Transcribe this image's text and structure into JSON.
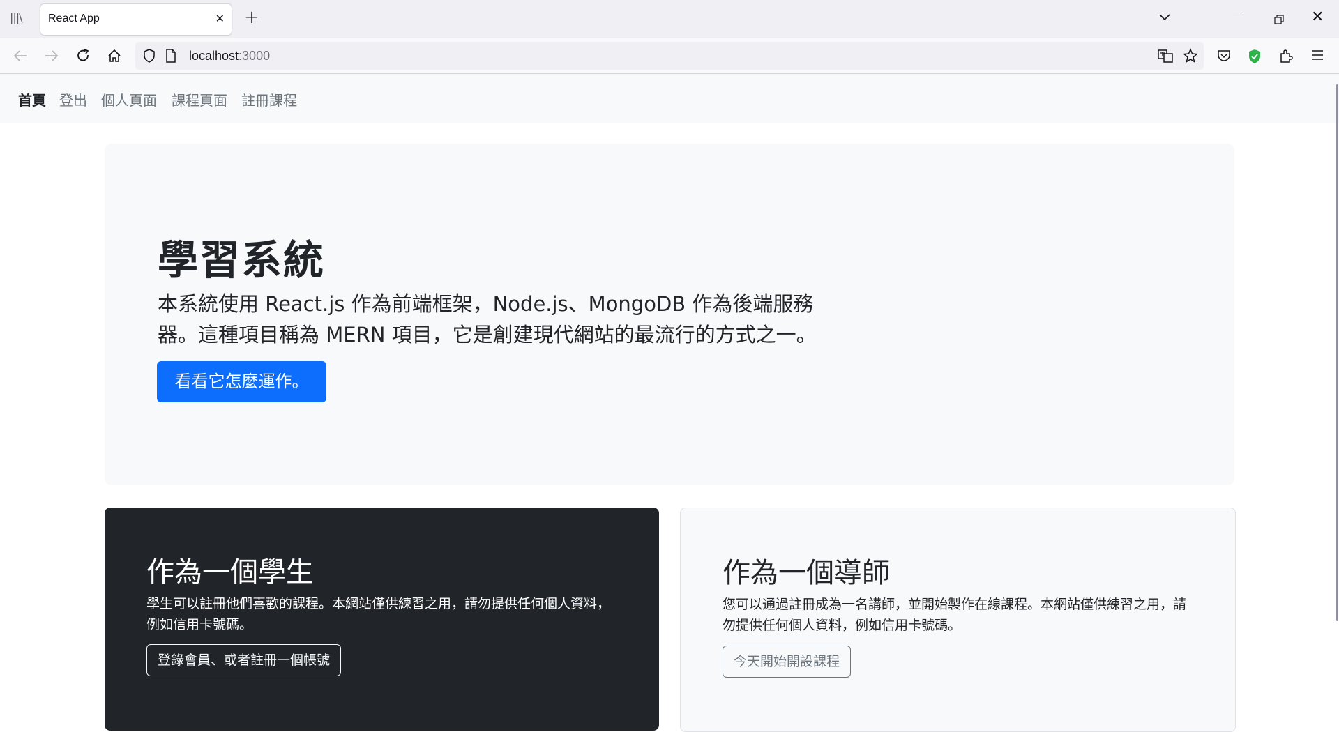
{
  "browser": {
    "tab_title": "React App",
    "url_host": "localhost",
    "url_port": ":3000"
  },
  "nav": {
    "items": [
      "首頁",
      "登出",
      "個人頁面",
      "課程頁面",
      "註冊課程"
    ]
  },
  "hero": {
    "title": "學習系統",
    "lead": "本系統使用 React.js 作為前端框架，Node.js、MongoDB 作為後端服務器。這種項目稱為 MERN 項目，它是創建現代網站的最流行的方式之一。",
    "button_label": "看看它怎麼運作。"
  },
  "student_card": {
    "title": "作為一個學生",
    "text": "學生可以註冊他們喜歡的課程。本網站僅供練習之用，請勿提供任何個人資料，例如信用卡號碼。",
    "button_label": "登錄會員、或者註冊一個帳號"
  },
  "instructor_card": {
    "title": "作為一個導師",
    "text": "您可以通過註冊成為一名講師，並開始製作在線課程。本網站僅供練習之用，請勿提供任何個人資料，例如信用卡號碼。",
    "button_label": "今天開始開設課程"
  },
  "colors": {
    "primary": "#0d6efd",
    "dark_card": "#212529",
    "light_bg": "#f8f9fa",
    "secondary": "#6c757d"
  }
}
